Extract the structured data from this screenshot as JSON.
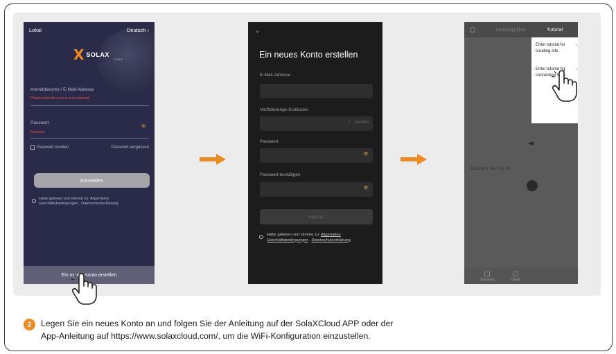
{
  "step_number": "2",
  "caption": {
    "line1": "Legen Sie ein neues Konto an und folgen Sie der Anleitung auf der SolaXCloud APP oder der",
    "line2": "App-Anleitung auf https://www.solaxcloud.com/, um die WiFi-Konfiguration einzustellen."
  },
  "colors": {
    "accent": "#f08a1c",
    "login_bg": "#2a2b48",
    "register_bg": "#1c1c1c",
    "error": "#e84a4a"
  },
  "login": {
    "local": "Lokal",
    "language": "Deutsch",
    "chevron_icon": "chevron-right-icon",
    "logo_mark": "X",
    "logo_text": "SOLAX",
    "logo_sub": "POWER",
    "account_label": "Anmeldekonto / E-Mail-Adresse",
    "account_error": "Please enter the correct account/email",
    "password_label": "Passwort",
    "password_error": "Passwort",
    "remember": "Passwort merken",
    "forgot": "Passwort vergessen",
    "login_button": "Anmelden",
    "agree_line1": "Habe gelesen und stimme zu: Allgemeine",
    "agree_line2": "Geschäftsbedingungen , Datenschutzerklärung",
    "new_account": "Ein neues Konto erstellen"
  },
  "register": {
    "back": "‹",
    "title": "Ein neues Konto erstellen",
    "email_label": "E-Mail-Adresse",
    "code_label": "Verifizierungs-Schlüssel",
    "send": "Senden",
    "password_label": "Passwort",
    "confirm_label": "Passwort bestätigen",
    "register_button": "registar",
    "agree_line1_prefix": "Habe gelesen und stimme zu: ",
    "agree_line1_link": "Allgemeine",
    "agree_line2_link": "Geschäftsbedingungen",
    "agree_line2_sep": " , ",
    "agree_line2_link2": "Datenschutzerklärung"
  },
  "tutorial_screen": {
    "user": "luoyang1@so",
    "menu_title": "Tutorial",
    "item1": "Enter tutorial for creating site",
    "item2": "Enter tutorial for connecting WiFi",
    "center_text": "Erstellen Sie Ihre W",
    "tab1": "Standorte",
    "tab2": "Gerät"
  }
}
